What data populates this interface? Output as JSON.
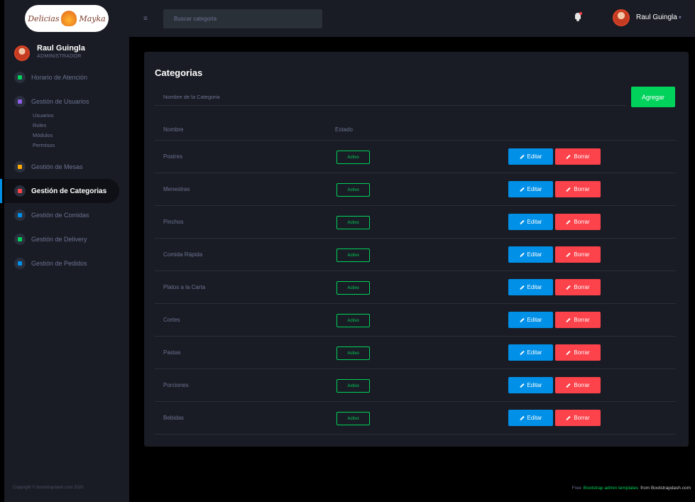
{
  "sidebar": {
    "logo_text": [
      "Delicias",
      "Mayka"
    ],
    "profile": {
      "name": "Raul Guingla",
      "role": "ADMINISTRADOR"
    },
    "nav": [
      {
        "label": "Horario de Atención",
        "color": "#00d25b"
      },
      {
        "label": "Gestión de Usuarios",
        "color": "#8f5fe8",
        "sub": [
          "Usuarios",
          "Roles",
          "Módulos",
          "Permisos"
        ]
      },
      {
        "label": "Gestión de Mesas",
        "color": "#ffab00"
      },
      {
        "label": "Gestión de Categorias",
        "color": "#fc424a",
        "active": true
      },
      {
        "label": "Gestión de Comidas",
        "color": "#0090e7"
      },
      {
        "label": "Gestión de Delivery",
        "color": "#00d25b"
      },
      {
        "label": "Gestión de Pedidos",
        "color": "#0090e7"
      }
    ],
    "footer": "Copyright © bootstrapdash.com 2020"
  },
  "topbar": {
    "search_placeholder": "Buscar categoria",
    "user_name": "Raul Guingla"
  },
  "card": {
    "title": "Categorias",
    "input_placeholder": "Nombre de la Categoria",
    "add_label": "Agregar",
    "headers": {
      "name": "Nombre",
      "state": "Estado"
    },
    "edit_label": "Editar",
    "delete_label": "Borrar",
    "rows": [
      {
        "name": "Postres",
        "state": "Activo"
      },
      {
        "name": "Menestras",
        "state": "Activo"
      },
      {
        "name": "Pinchos",
        "state": "Activo"
      },
      {
        "name": "Comida Rápida",
        "state": "Activo"
      },
      {
        "name": "Platos a la Carta",
        "state": "Activo"
      },
      {
        "name": "Cortes",
        "state": "Activo"
      },
      {
        "name": "Pastas",
        "state": "Activo"
      },
      {
        "name": "Porciones",
        "state": "Activo"
      },
      {
        "name": "Bebidas",
        "state": "Activo"
      }
    ]
  },
  "footer": {
    "prefix": "Free",
    "link": "Bootstrap admin templates",
    "suffix": "from Bootstrapdash.com"
  },
  "colors": {
    "accent_green": "#00d25b",
    "accent_blue": "#0090e7",
    "accent_red": "#fc424a",
    "bg_card": "#191c24"
  }
}
